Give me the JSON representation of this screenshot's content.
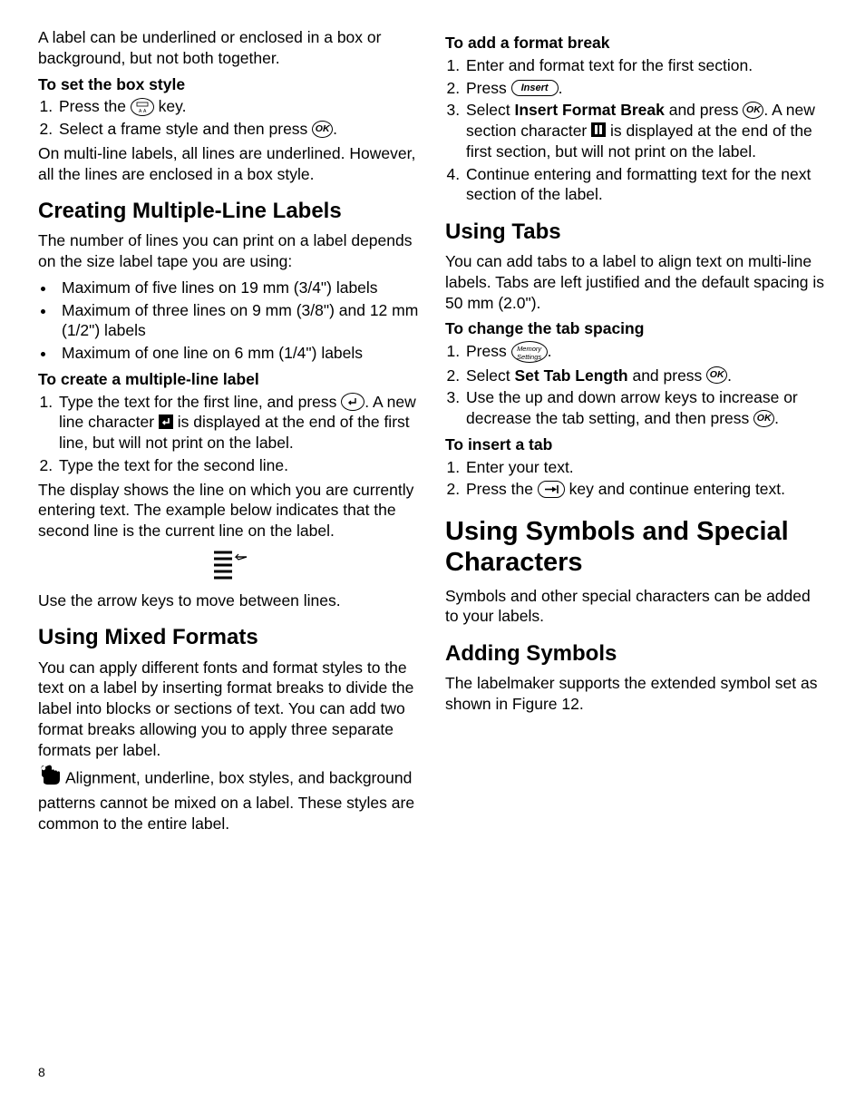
{
  "left": {
    "intro": "A label can be underlined or enclosed in a box or background, but not both together.",
    "boxStyle": {
      "heading": "To set the box style",
      "step1a": "Press the ",
      "step1b": " key.",
      "step2a": "Select a frame style and then press ",
      "step2b": ".",
      "p1": "On multi-line labels, all lines are underlined. However, all the lines are enclosed in a box style."
    },
    "multiLine": {
      "heading": "Creating Multiple-Line Labels",
      "intro": "The number of lines you can print on a label depends on the size label tape you are using:",
      "b1": "Maximum of five lines on 19 mm (3/4\") labels",
      "b2": "Maximum of three lines on 9 mm (3/8\") and 12 mm (1/2\") labels",
      "b3": "Maximum of one line on 6 mm (1/4\") labels",
      "subheading": "To create a multiple-line label",
      "s1a": "Type the text for the first line, and press ",
      "s1b": ". A new line character ",
      "s1c": " is displayed at the end of the first line, but will not print on the label.",
      "s2": "Type the text for the second line.",
      "p1": "The display shows the line on which you are currently entering text. The example below indicates that the second line is the current line on the label.",
      "p2": "Use the arrow keys to move between lines."
    },
    "mixed": {
      "heading": "Using Mixed Formats",
      "p1": "You can apply different fonts and format styles to the text on a label by inserting format breaks to divide the label into blocks or sections of text. You can add two format breaks allowing you to apply three separate formats per label.",
      "tip": "Alignment, underline, box styles, and background patterns cannot be mixed on a label. These styles are common to the entire label."
    }
  },
  "right": {
    "formatBreak": {
      "heading": "To add a format break",
      "s1": "Enter and format text for the first section.",
      "s2a": "Press ",
      "s2b": ".",
      "s3a": "Select ",
      "s3bold": "Insert Format Break",
      "s3b": " and press ",
      "s3c": ". A new section character ",
      "s3d": " is displayed at the end of the first section, but will not print on the label.",
      "s4": "Continue entering and formatting text for the next section of the label."
    },
    "tabs": {
      "heading": "Using Tabs",
      "p1": "You can add tabs to a label to align text on multi-line labels. Tabs are left justified and the default spacing is 50 mm (2.0\").",
      "sub1": "To change the tab spacing",
      "s1a": "Press ",
      "s1b": ".",
      "s2a": "Select ",
      "s2bold": "Set Tab Length",
      "s2b": " and press ",
      "s2c": ".",
      "s3a": "Use the up and down arrow keys to increase or decrease the tab setting, and then press ",
      "s3b": ".",
      "sub2": "To insert a tab",
      "t1": "Enter your text.",
      "t2a": "Press the ",
      "t2b": " key and continue entering text."
    },
    "symbols": {
      "heading": "Using Symbols and Special Characters",
      "p1": "Symbols and other special characters can be added to your labels."
    },
    "adding": {
      "heading": "Adding Symbols",
      "p1": "The labelmaker supports the extended symbol set as shown in Figure 12."
    }
  },
  "icons": {
    "ok": "OK",
    "insert": "Insert",
    "memory": "Memory",
    "settings": "Settings"
  },
  "pageNum": "8"
}
